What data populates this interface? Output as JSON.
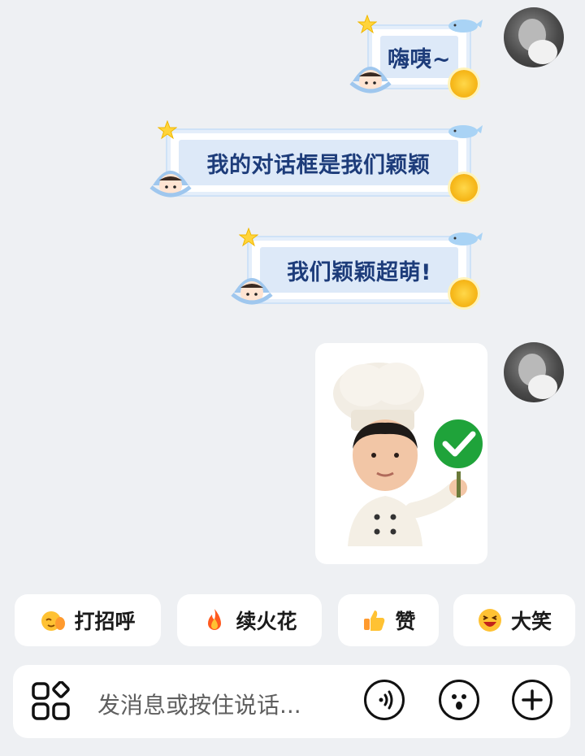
{
  "messages": [
    {
      "text": "嗨咦~"
    },
    {
      "text": "我的对话框是我们颖颖"
    },
    {
      "text": "我们颖颖超萌!"
    }
  ],
  "sticker": {
    "name": "chef-thumbs-ok-sticker"
  },
  "quick_replies": [
    {
      "label": "打招呼",
      "icon": "wave-emoji-icon"
    },
    {
      "label": "续火花",
      "icon": "fire-icon"
    },
    {
      "label": "赞",
      "icon": "thumbs-up-icon"
    },
    {
      "label": "大笑",
      "icon": "laughing-emoji-icon"
    }
  ],
  "input": {
    "placeholder": "发消息或按住说话..."
  },
  "colors": {
    "bubble_text": "#1d3c7a",
    "bubble_fill": "#dde9f8",
    "background": "#eef0f3"
  }
}
